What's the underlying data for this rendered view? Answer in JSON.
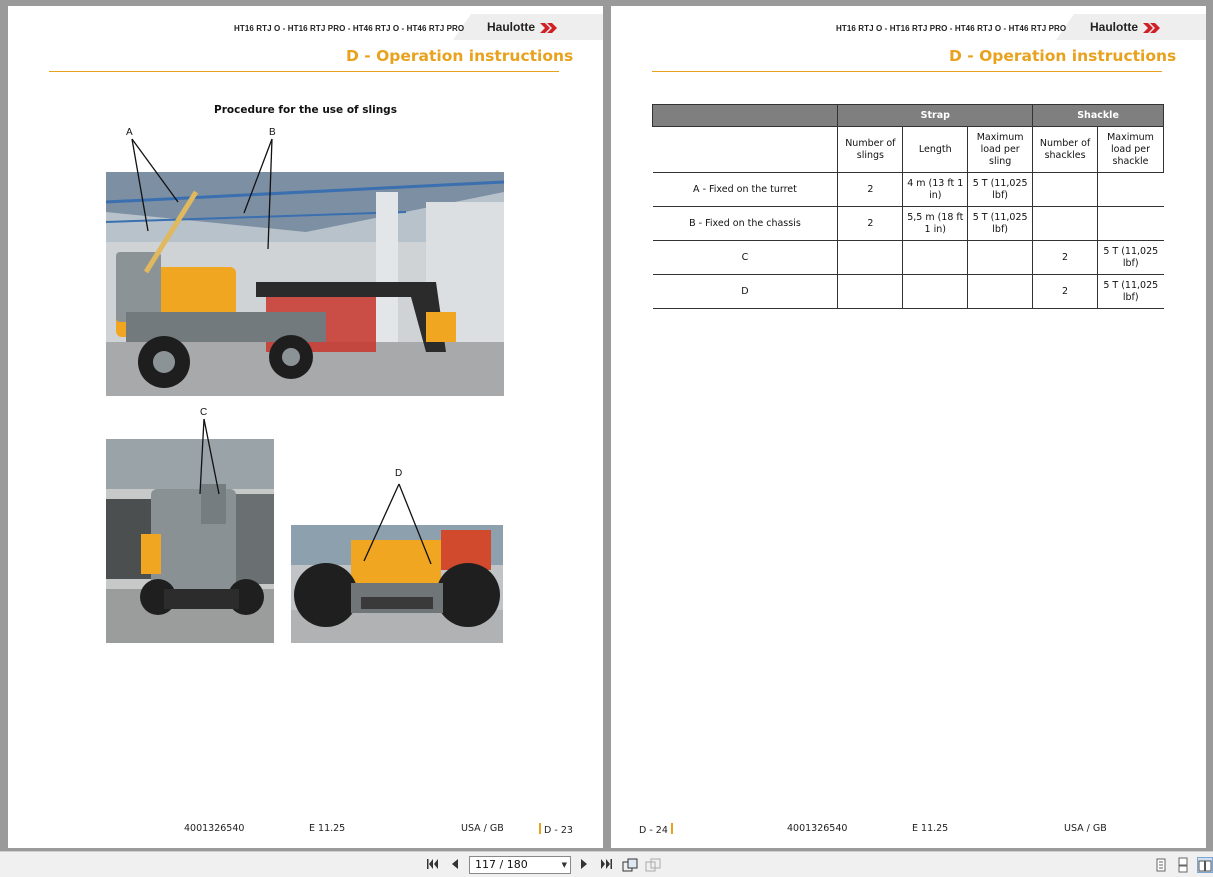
{
  "header": {
    "models": "HT16 RTJ O - HT16 RTJ PRO - HT46 RTJ O - HT46 RTJ PRO",
    "models_right": "HT16 RTJ O - HT16 RTJ PRO - HT46 RTJ O - HT46 RTJ PRO",
    "logo": "Haulotte",
    "section": "D - Operation instructions"
  },
  "left_page": {
    "procedure_title": "Procedure for the use of slings",
    "callouts": [
      "A",
      "B",
      "C",
      "D"
    ],
    "footer": {
      "doc_number": "4001326540",
      "edition": "E 11.25",
      "region": "USA / GB",
      "page": "D - 23"
    }
  },
  "right_page": {
    "table": {
      "group_headers": [
        "Strap",
        "Shackle"
      ],
      "sub_headers": [
        "Number of slings",
        "Length",
        "Maximum load per sling",
        "Number of shackles",
        "Maximum load per shackle"
      ],
      "rows": [
        {
          "label": "A -  Fixed on the turret",
          "slings": "2",
          "length": "4 m (13 ft 1 in)",
          "load_sling": "5 T (11,025 lbf)",
          "shackles": "",
          "load_shackle": ""
        },
        {
          "label": "B -  Fixed on the chassis",
          "slings": "2",
          "length": "5,5 m (18 ft 1 in)",
          "load_sling": "5 T (11,025 lbf)",
          "shackles": "",
          "load_shackle": ""
        },
        {
          "label": "C",
          "slings": "",
          "length": "",
          "load_sling": "",
          "shackles": "2",
          "load_shackle": "5 T (11,025 lbf)"
        },
        {
          "label": "D",
          "slings": "",
          "length": "",
          "load_sling": "",
          "shackles": "2",
          "load_shackle": "5 T (11,025 lbf)"
        }
      ]
    },
    "footer": {
      "page": "D - 24",
      "doc_number": "4001326540",
      "edition": "E 11.25",
      "region": "USA / GB"
    }
  },
  "toolbar": {
    "page_indicator": "117 / 180",
    "icons": [
      "first-page-icon",
      "previous-page-icon",
      "next-page-icon",
      "last-page-icon",
      "rotate-page-icon",
      "rotate-back-icon",
      "single-page-view-icon",
      "continuous-view-icon",
      "two-page-view-icon"
    ]
  },
  "colors": {
    "accent": "#e8a21e",
    "logo_red": "#d11f26",
    "table_header": "#7f7f7f",
    "machine_yellow": "#f0a621",
    "machine_grey": "#8c9396"
  }
}
